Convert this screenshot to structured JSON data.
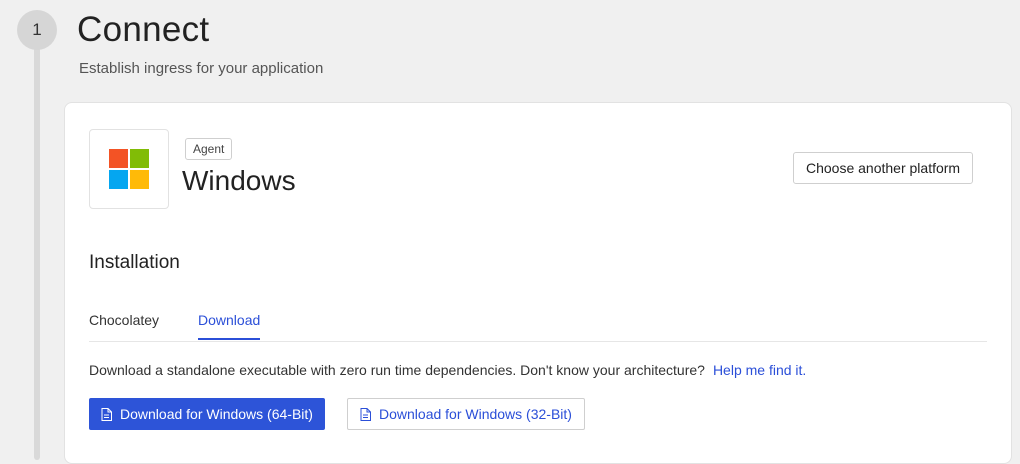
{
  "step": {
    "number": "1",
    "title": "Connect",
    "subtitle": "Establish ingress for your application"
  },
  "platform": {
    "tag": "Agent",
    "name": "Windows",
    "logo_icon": "windows-logo-icon",
    "logo_colors": [
      "#f35325",
      "#81bc06",
      "#05a6f0",
      "#ffba08"
    ],
    "choose_button": "Choose another platform"
  },
  "installation": {
    "title": "Installation",
    "tabs": [
      {
        "label": "Chocolatey",
        "active": false
      },
      {
        "label": "Download",
        "active": true
      }
    ],
    "description": "Download a standalone executable with zero run time dependencies. Don't know your architecture?",
    "help_link": "Help me find it.",
    "buttons": [
      {
        "label": "Download for Windows (64-Bit)",
        "icon": "file-icon",
        "style": "primary"
      },
      {
        "label": "Download for Windows (32-Bit)",
        "icon": "file-icon",
        "style": "secondary"
      }
    ]
  },
  "colors": {
    "accent": "#2d54d8",
    "background": "#f0f0f0"
  }
}
